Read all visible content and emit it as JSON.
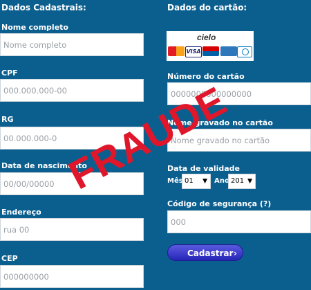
{
  "personal": {
    "section_title": "Dados Cadastrais:",
    "fields": [
      {
        "label": "Nome completo",
        "placeholder": "Nome completo"
      },
      {
        "label": "CPF",
        "placeholder": "000.000.000-00"
      },
      {
        "label": "RG",
        "placeholder": "00.000.000-0"
      },
      {
        "label": "Data de nascimento",
        "placeholder": "00/00/00000"
      },
      {
        "label": "Endereço",
        "placeholder": "rua 00"
      },
      {
        "label": "CEP",
        "placeholder": "000000000"
      }
    ]
  },
  "card": {
    "section_title": "Dados do cartão:",
    "brand_logo_text": "cielo",
    "brands": [
      "MasterCard",
      "VISA",
      "Maestro",
      "American Express",
      "Diners Club"
    ],
    "number_label": "Número do cartão",
    "number_placeholder": "0000000000000000",
    "name_label": "Nome gravado no cartão",
    "name_placeholder": "Nome gravado no cartão",
    "expiry_label": "Data de validade",
    "month_label": "Mês",
    "month_value": "01",
    "year_label": "Ano",
    "year_value": "201",
    "cvv_label": "Código de segurança (?)",
    "cvv_placeholder": "000",
    "submit_label": "Cadastrar",
    "submit_icon": "chevron-right-icon"
  },
  "overlay": {
    "stamp_text": "FRAUDE",
    "stamp_color": "#e0162a"
  },
  "colors": {
    "background": "#0b5f8f",
    "button": "#2626b8"
  }
}
